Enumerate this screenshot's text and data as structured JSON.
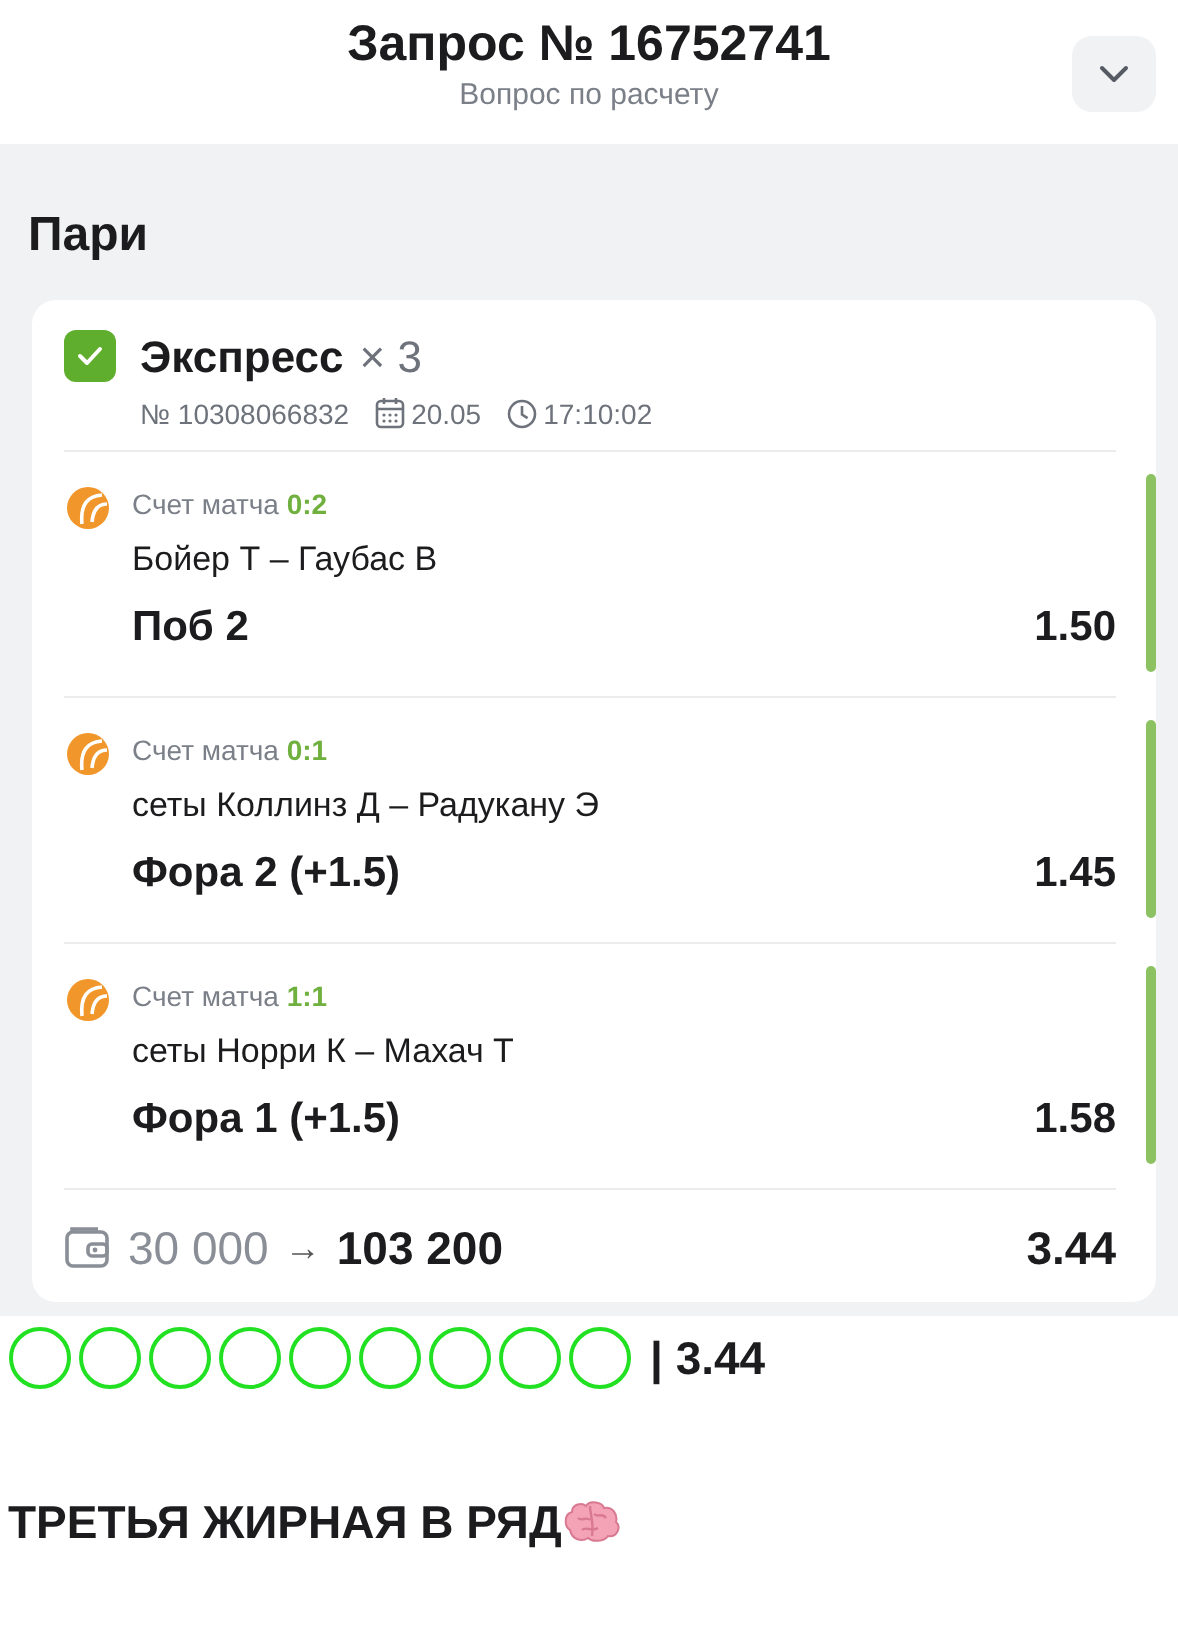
{
  "header": {
    "title": "Запрос № 16752741",
    "subtitle": "Вопрос по расчету"
  },
  "section_title": "Пари",
  "bet": {
    "checked": true,
    "type": "Экспресс",
    "multiplier": "× 3",
    "number": "№ 10308066832",
    "date": "20.05",
    "time": "17:10:02",
    "legs": [
      {
        "score_label": "Счет матча",
        "score": "0:2",
        "match": "Бойер Т – Гаубас В",
        "pick": "Поб 2",
        "odds": "1.50",
        "won": true
      },
      {
        "score_label": "Счет матча",
        "score": "0:1",
        "match": "сеты Коллинз Д – Радукану Э",
        "pick": "Фора 2 (+1.5)",
        "odds": "1.45",
        "won": true
      },
      {
        "score_label": "Счет матча",
        "score": "1:1",
        "match": "сеты Норри К – Махач Т",
        "pick": "Фора 1 (+1.5)",
        "odds": "1.58",
        "won": true
      }
    ],
    "stake": "30 000",
    "arrow": "→",
    "payout": "103 200",
    "total_odds": "3.44"
  },
  "message": {
    "marks": [
      {
        "kind": "circle"
      },
      {
        "kind": "circle"
      },
      {
        "kind": "circle"
      },
      {
        "kind": "circle"
      },
      {
        "kind": "circle"
      },
      {
        "kind": "circle"
      },
      {
        "kind": "circle"
      },
      {
        "kind": "circle"
      },
      {
        "kind": "circle"
      }
    ],
    "odds_text": "| 3.44",
    "text": "ТРЕТЬЯ ЖИРНАЯ В РЯД"
  }
}
